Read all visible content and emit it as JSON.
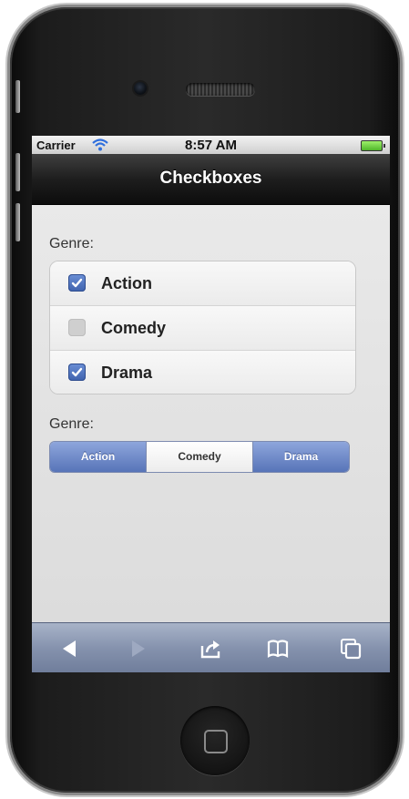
{
  "status_bar": {
    "carrier": "Carrier",
    "time": "8:57 AM"
  },
  "nav": {
    "title": "Checkboxes"
  },
  "checkbox_group": {
    "label": "Genre:",
    "items": [
      {
        "label": "Action",
        "checked": true
      },
      {
        "label": "Comedy",
        "checked": false
      },
      {
        "label": "Drama",
        "checked": true
      }
    ]
  },
  "segmented_group": {
    "label": "Genre:",
    "items": [
      {
        "label": "Action",
        "selected": true
      },
      {
        "label": "Comedy",
        "selected": false
      },
      {
        "label": "Drama",
        "selected": true
      }
    ]
  },
  "toolbar": {
    "icons": [
      "back-arrow-icon",
      "forward-arrow-icon",
      "share-icon",
      "bookmarks-icon",
      "tabs-icon"
    ]
  },
  "colors": {
    "checked": "#4a6cb8",
    "toolbar": "#8592ad",
    "nav_bar": "#1e1e1e"
  }
}
